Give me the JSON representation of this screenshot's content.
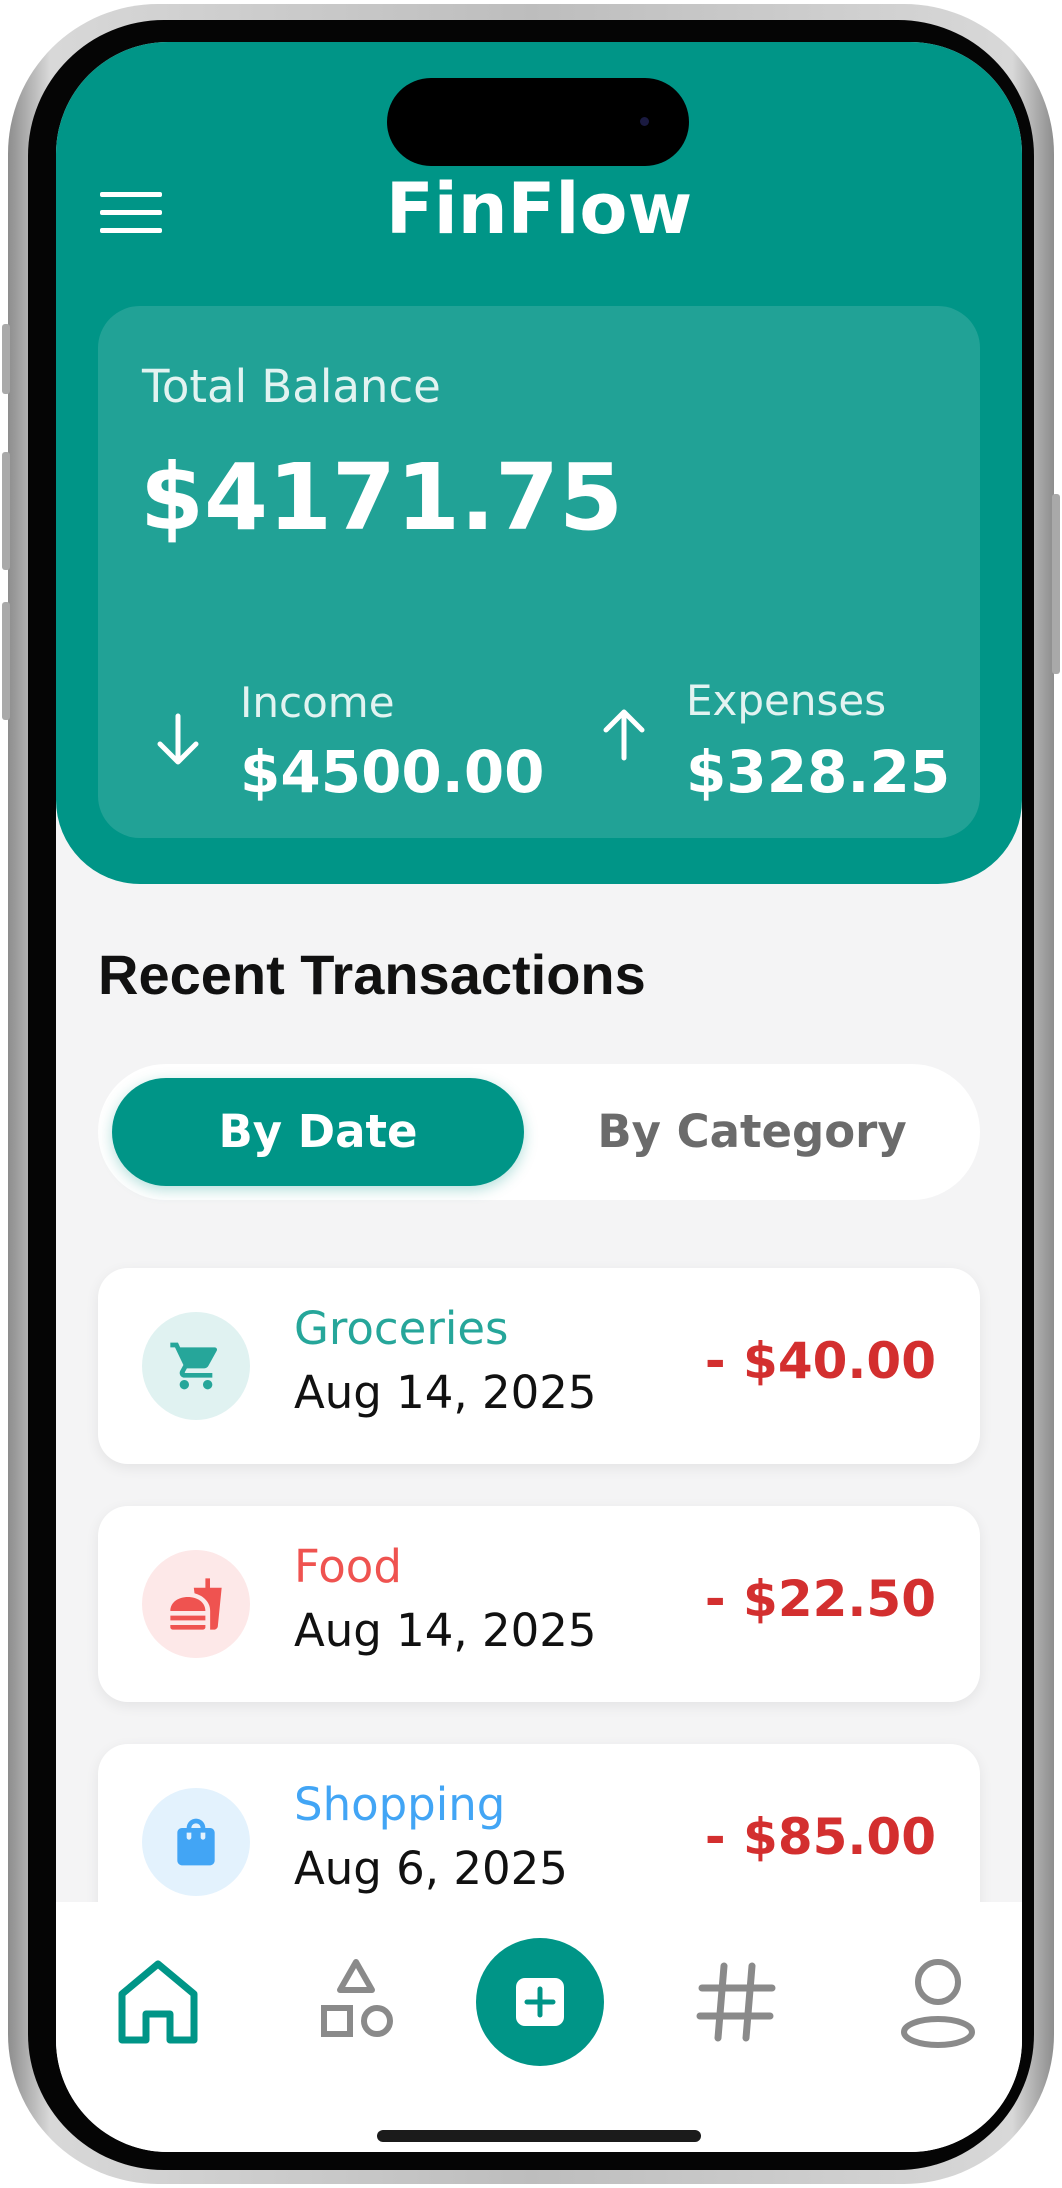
{
  "app": {
    "title": "FinFlow",
    "menu_icon": "hamburger-menu-icon"
  },
  "balance": {
    "label": "Total Balance",
    "value": "$4171.75",
    "income": {
      "label": "Income",
      "value": "$4500.00",
      "icon": "arrow-down-icon"
    },
    "expenses": {
      "label": "Expenses",
      "value": "$328.25",
      "icon": "arrow-up-icon"
    }
  },
  "transactions": {
    "section_title": "Recent Transactions",
    "tabs": [
      {
        "label": "By Date",
        "active": true
      },
      {
        "label": "By Category",
        "active": false
      }
    ],
    "items": [
      {
        "category": "Groceries",
        "date": "Aug 14, 2025",
        "amount": "- $40.00",
        "icon": "shopping-cart-icon",
        "color": "#26a69a",
        "bg": "#e0f2f1"
      },
      {
        "category": "Food",
        "date": "Aug 14, 2025",
        "amount": "- $22.50",
        "icon": "fastfood-icon",
        "color": "#ef5350",
        "bg": "#fde8e8"
      },
      {
        "category": "Shopping",
        "date": "Aug 6, 2025",
        "amount": "- $85.00",
        "icon": "shopping-bag-icon",
        "color": "#42a5f5",
        "bg": "#e3f2fd"
      }
    ]
  },
  "nav": {
    "items": [
      "home-icon",
      "categories-icon",
      "add-icon",
      "hashtag-icon",
      "profile-icon"
    ],
    "active": "home-icon"
  },
  "colors": {
    "primary": "#009587",
    "expense": "#d32f2f",
    "background": "#f4f4f5"
  }
}
